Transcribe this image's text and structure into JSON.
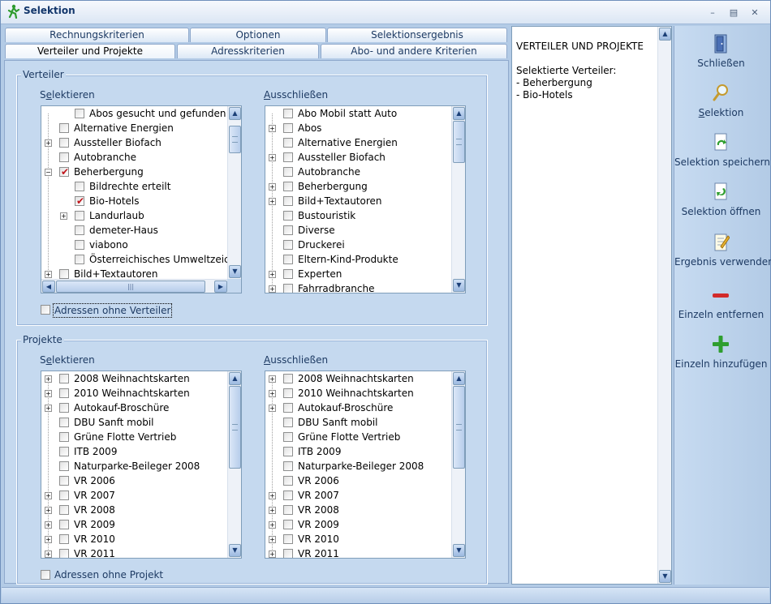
{
  "window": {
    "title": "Selektion"
  },
  "tabs": {
    "row1": [
      "Rechnungskriterien",
      "Optionen",
      "Selektionsergebnis"
    ],
    "row2": [
      "Verteiler und Projekte",
      "Adresskriterien",
      "Abo- und andere Kriterien"
    ]
  },
  "verteiler": {
    "legend": "Verteiler",
    "select_label": "Selektieren",
    "select_mnemonic": "e",
    "exclude_label": "Ausschließen",
    "exclude_mnemonic": "A",
    "select_items": [
      {
        "label": "Abos gesucht und gefunden",
        "level": 1,
        "expander": false,
        "checked": false
      },
      {
        "label": "Alternative Energien",
        "level": 0,
        "expander": false,
        "checked": false
      },
      {
        "label": "Aussteller Biofach",
        "level": 0,
        "expander": true,
        "checked": false
      },
      {
        "label": "Autobranche",
        "level": 0,
        "expander": false,
        "checked": false
      },
      {
        "label": "Beherbergung",
        "level": 0,
        "expander": true,
        "expanded": true,
        "checked": true
      },
      {
        "label": "Bildrechte erteilt",
        "level": 1,
        "expander": false,
        "checked": false
      },
      {
        "label": "Bio-Hotels",
        "level": 1,
        "expander": false,
        "checked": true
      },
      {
        "label": "Landurlaub",
        "level": 1,
        "expander": true,
        "checked": false
      },
      {
        "label": "demeter-Haus",
        "level": 1,
        "expander": false,
        "checked": false
      },
      {
        "label": "viabono",
        "level": 1,
        "expander": false,
        "checked": false
      },
      {
        "label": "Österreichisches Umweltzeichen",
        "level": 1,
        "expander": false,
        "checked": false
      },
      {
        "label": "Bild+Textautoren",
        "level": 0,
        "expander": true,
        "checked": false
      }
    ],
    "exclude_items": [
      {
        "label": "Abo Mobil statt Auto",
        "expander": false
      },
      {
        "label": "Abos",
        "expander": true
      },
      {
        "label": "Alternative Energien",
        "expander": false
      },
      {
        "label": "Aussteller Biofach",
        "expander": true
      },
      {
        "label": "Autobranche",
        "expander": false
      },
      {
        "label": "Beherbergung",
        "expander": true
      },
      {
        "label": "Bild+Textautoren",
        "expander": true
      },
      {
        "label": "Bustouristik",
        "expander": false
      },
      {
        "label": "Diverse",
        "expander": false
      },
      {
        "label": "Druckerei",
        "expander": false
      },
      {
        "label": "Eltern-Kind-Produkte",
        "expander": false
      },
      {
        "label": "Experten",
        "expander": true
      },
      {
        "label": "Fahrradbranche",
        "expander": true
      }
    ],
    "option_label": "Adressen ohne Verteiler"
  },
  "projekte": {
    "legend": "Projekte",
    "select_label": "Selektieren",
    "select_mnemonic": "e",
    "exclude_label": "Ausschließen",
    "exclude_mnemonic": "A",
    "items": [
      {
        "label": "2008 Weihnachtskarten",
        "expander": true
      },
      {
        "label": "2010 Weihnachtskarten",
        "expander": true
      },
      {
        "label": "Autokauf-Broschüre",
        "expander": true
      },
      {
        "label": "DBU Sanft mobil",
        "expander": false
      },
      {
        "label": "Grüne Flotte Vertrieb",
        "expander": false
      },
      {
        "label": "ITB 2009",
        "expander": false
      },
      {
        "label": "Naturparke-Beileger 2008",
        "expander": false
      },
      {
        "label": "VR 2006",
        "expander": false
      },
      {
        "label": "VR 2007",
        "expander": true
      },
      {
        "label": "VR 2008",
        "expander": true
      },
      {
        "label": "VR 2009",
        "expander": true
      },
      {
        "label": "VR 2010",
        "expander": true
      },
      {
        "label": "VR 2011",
        "expander": true
      }
    ],
    "option_label": "Adressen ohne Projekt"
  },
  "summary": {
    "lines": [
      "VERTEILER UND PROJEKTE",
      "",
      "Selektierte Verteiler:",
      "- Beherbergung",
      "- Bio-Hotels"
    ]
  },
  "actions": [
    {
      "label": "Schließen",
      "icon": "door-icon",
      "mnemonic": ""
    },
    {
      "label": "Selektion",
      "icon": "magnifier-icon",
      "mnemonic": "S"
    },
    {
      "label": "Selektion speichern",
      "icon": "save-selection-icon",
      "mnemonic": ""
    },
    {
      "label": "Selektion öffnen",
      "icon": "open-selection-icon",
      "mnemonic": ""
    },
    {
      "label": "Ergebnis verwenden",
      "icon": "use-result-icon",
      "mnemonic": ""
    },
    {
      "label": "Einzeln entfernen",
      "icon": "minus-icon",
      "mnemonic": ""
    },
    {
      "label": "Einzeln hinzufügen",
      "icon": "plus-icon",
      "mnemonic": ""
    }
  ],
  "colors": {
    "accent": "#1d3a63",
    "check": "#c0141a",
    "add": "#2f9e2f",
    "remove": "#d22a2a"
  }
}
